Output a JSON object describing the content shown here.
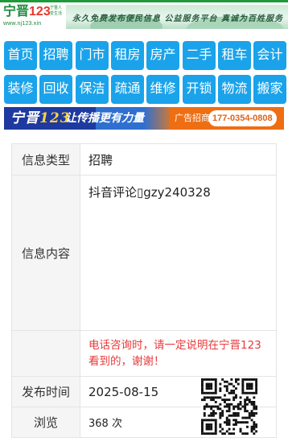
{
  "header": {
    "logo_cn": "宁晋",
    "logo_num": "123",
    "logo_tag": "宁晋人\n爱生活",
    "logo_url": "www.nj123.xin",
    "slogan": "永久免费发布便民信息  公益服务平台  真诚为百姓服务"
  },
  "nav": {
    "items": [
      {
        "label": "首页"
      },
      {
        "label": "招聘"
      },
      {
        "label": "门市"
      },
      {
        "label": "租房"
      },
      {
        "label": "房产"
      },
      {
        "label": "二手"
      },
      {
        "label": "租车"
      },
      {
        "label": "会计"
      },
      {
        "label": "装修"
      },
      {
        "label": "回收"
      },
      {
        "label": "保洁"
      },
      {
        "label": "疏通"
      },
      {
        "label": "维修"
      },
      {
        "label": "开锁"
      },
      {
        "label": "物流"
      },
      {
        "label": "搬家"
      }
    ],
    "color": "#1aa3ea"
  },
  "ad": {
    "logo_cn": "宁晋",
    "logo_num": "123",
    "slogan": "让传播更有力量",
    "label": "广告招商",
    "phone": "177-0354-0808"
  },
  "info": {
    "type_label": "信息类型",
    "type_value": "招聘",
    "content_label": "信息内容",
    "content_value": "抖音评论▯gzy240328",
    "tip": "电话咨询时，请一定说明在宁晋123看到的，谢谢！",
    "date_label": "发布时间",
    "date_value": "2025-08-15",
    "views_label": "浏览",
    "views_value": "368 次"
  },
  "colors": {
    "accent": "#1aa3ea",
    "tip": "#e8393a",
    "brand_green": "#1a8a3a",
    "ad_orange": "#ee6e14"
  }
}
